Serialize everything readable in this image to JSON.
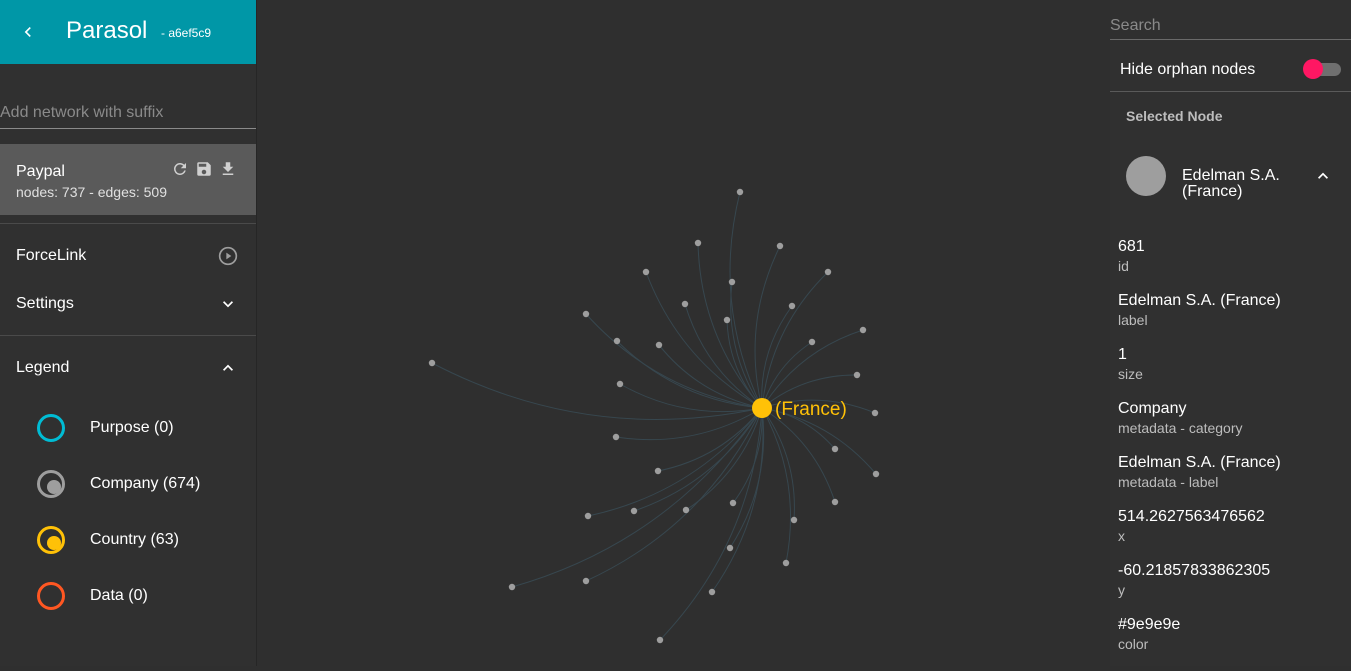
{
  "header": {
    "title": "Parasol",
    "id_suffix": "- a6ef5c9"
  },
  "add_network": {
    "placeholder": "Add network with suffix"
  },
  "network": {
    "name": "Paypal",
    "stats": "nodes: 737 - edges: 509"
  },
  "menu": {
    "layout": "ForceLink",
    "settings": "Settings",
    "legend": "Legend"
  },
  "legend": [
    {
      "label": "Purpose (0)",
      "color": "#00bcd4",
      "filled": false
    },
    {
      "label": "Company (674)",
      "color": "#9e9e9e",
      "filled": true
    },
    {
      "label": "Country (63)",
      "color": "#ffc107",
      "filled": true
    },
    {
      "label": "Data (0)",
      "color": "#ff5722",
      "filled": false
    }
  ],
  "graph": {
    "center_label": "(France)",
    "center_color": "#ffc107",
    "node_color": "#9e9e9e",
    "edge_color": "#37474f"
  },
  "right_panel": {
    "search_placeholder": "Search",
    "hide_orphans_label": "Hide orphan nodes",
    "hide_orphans_on": true,
    "toggle_color": "#ff1763",
    "selected_title": "Selected Node",
    "node": {
      "name": "Edelman S.A. (France)",
      "color": "#9e9e9e"
    },
    "properties": [
      {
        "value": "681",
        "key": "id"
      },
      {
        "value": "Edelman S.A. (France)",
        "key": "label"
      },
      {
        "value": "1",
        "key": "size"
      },
      {
        "value": "Company",
        "key": "metadata - category"
      },
      {
        "value": "Edelman S.A. (France)",
        "key": "metadata - label"
      },
      {
        "value": "514.2627563476562",
        "key": "x"
      },
      {
        "value": "-60.21857833862305",
        "key": "y"
      },
      {
        "value": "#9e9e9e",
        "key": "color"
      }
    ]
  }
}
